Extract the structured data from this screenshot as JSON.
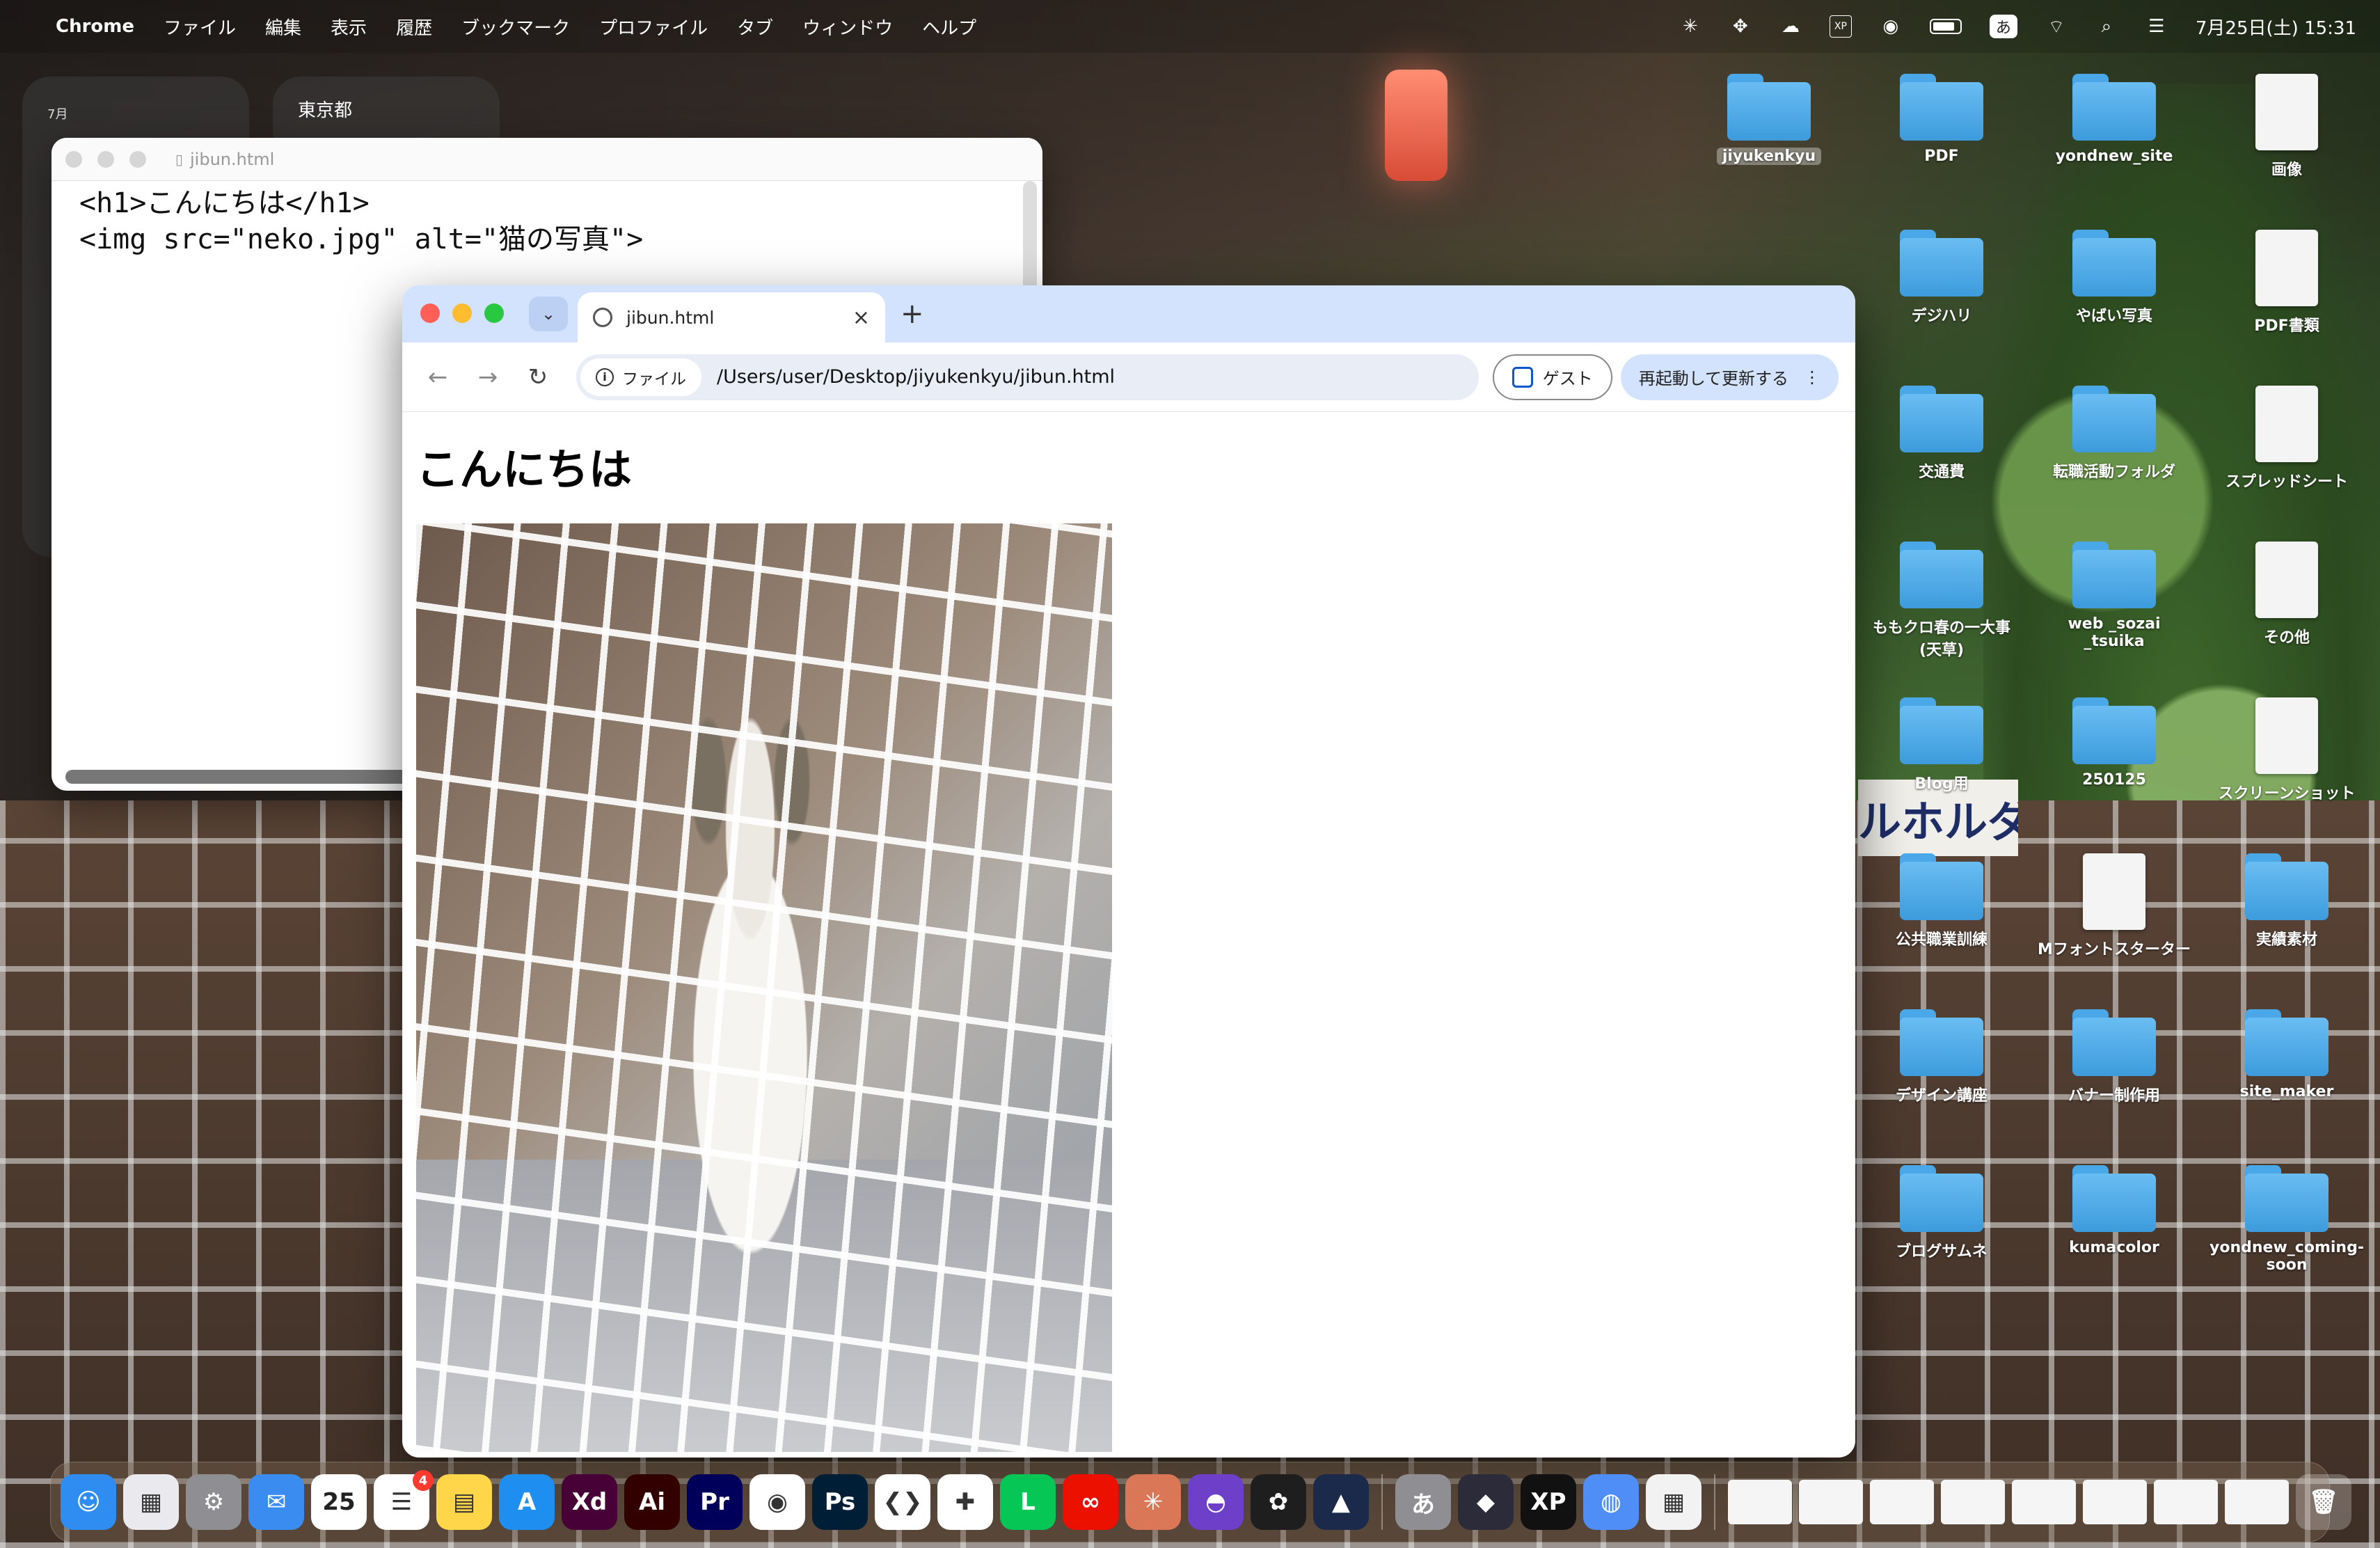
{
  "menubar": {
    "app_name": "Chrome",
    "menus": [
      "ファイル",
      "編集",
      "表示",
      "履歴",
      "ブックマーク",
      "プロファイル",
      "タブ",
      "ウィンドウ",
      "ヘルプ"
    ],
    "ime_label": "あ",
    "clock": "7月25日(土) 15:31"
  },
  "widgets": {
    "calendar_month": "7月",
    "weather_location": "東京都"
  },
  "editor": {
    "title": "jibun.html",
    "line1": "<h1>こんにちは</h1>",
    "line2": "<img src=\"neko.jpg\" alt=\"猫の写真\">"
  },
  "browser": {
    "tab_title": "jibun.html",
    "file_chip": "ファイル",
    "url": "/Users/user/Desktop/jiyukenkyu/jibun.html",
    "guest_label": "ゲスト",
    "relaunch_label": "再起動して更新する",
    "page_heading": "こんにちは",
    "image_alt": "猫の写真"
  },
  "wallpaper": {
    "sign_text": "ルホルダー"
  },
  "desktop": {
    "items": [
      {
        "label": "jiyukenkyu",
        "kind": "folder",
        "selected": true
      },
      {
        "label": "PDF",
        "kind": "folder"
      },
      {
        "label": "yondnew_site",
        "kind": "folder"
      },
      {
        "label": "画像",
        "kind": "doc"
      },
      {
        "label": "デジハリ",
        "kind": "folder"
      },
      {
        "label": "やばい写真",
        "kind": "folder"
      },
      {
        "label": "PDF書類",
        "kind": "doc"
      },
      {
        "label": "交通費",
        "kind": "folder"
      },
      {
        "label": "転職活動フォルダ",
        "kind": "folder"
      },
      {
        "label": "スプレッドシート",
        "kind": "doc"
      },
      {
        "label": "ももクロ春の一大事(天草)",
        "kind": "folder"
      },
      {
        "label": "web _sozai _tsuika",
        "kind": "folder"
      },
      {
        "label": "その他",
        "kind": "doc"
      },
      {
        "label": "Blog用",
        "kind": "folder"
      },
      {
        "label": "250125",
        "kind": "folder"
      },
      {
        "label": "スクリーンショット",
        "kind": "doc"
      },
      {
        "label": "公共職業訓練",
        "kind": "folder"
      },
      {
        "label": "Mフォントスターター",
        "kind": "doc"
      },
      {
        "label": "実績素材",
        "kind": "folder"
      },
      {
        "label": "デザイン講座",
        "kind": "folder"
      },
      {
        "label": "バナー制作用",
        "kind": "folder"
      },
      {
        "label": "site_maker",
        "kind": "folder"
      },
      {
        "label": "ブログサムネ",
        "kind": "folder"
      },
      {
        "label": "kumacolor",
        "kind": "folder"
      },
      {
        "label": "yondnew_coming-soon",
        "kind": "folder"
      }
    ]
  },
  "dock": {
    "calendar_day": "25",
    "reminders_badge": "4",
    "apps": [
      {
        "name": "finder-icon",
        "glyph": "☺",
        "color": "#2f8df2"
      },
      {
        "name": "launchpad-icon",
        "glyph": "▦",
        "color": "#e9e9ee"
      },
      {
        "name": "system-settings-icon",
        "glyph": "⚙",
        "color": "#8e8e93"
      },
      {
        "name": "mail-icon",
        "glyph": "✉",
        "color": "#3a8cf0"
      },
      {
        "name": "calendar-icon",
        "glyph": "",
        "color": "#ffffff"
      },
      {
        "name": "reminders-icon",
        "glyph": "☰",
        "color": "#ffffff"
      },
      {
        "name": "notes-icon",
        "glyph": "▤",
        "color": "#ffd54a"
      },
      {
        "name": "app-store-icon",
        "glyph": "A",
        "color": "#1f8ef1"
      },
      {
        "name": "adobe-xd-icon",
        "glyph": "Xd",
        "color": "#470137"
      },
      {
        "name": "illustrator-icon",
        "glyph": "Ai",
        "color": "#330000"
      },
      {
        "name": "premiere-icon",
        "glyph": "Pr",
        "color": "#00005b"
      },
      {
        "name": "chrome-icon",
        "glyph": "◉",
        "color": "#ffffff"
      },
      {
        "name": "photoshop-icon",
        "glyph": "Ps",
        "color": "#001e36"
      },
      {
        "name": "vscode-icon",
        "glyph": "❮❯",
        "color": "#ffffff"
      },
      {
        "name": "slack-icon",
        "glyph": "✚",
        "color": "#ffffff"
      },
      {
        "name": "line-icon",
        "glyph": "L",
        "color": "#06c755"
      },
      {
        "name": "creative-cloud-icon",
        "glyph": "∞",
        "color": "#eb1000"
      },
      {
        "name": "claude-icon",
        "glyph": "✳",
        "color": "#d97757"
      },
      {
        "name": "github-icon",
        "glyph": "◓",
        "color": "#6e40c9"
      },
      {
        "name": "figma-icon",
        "glyph": "✿",
        "color": "#1e1e1e"
      },
      {
        "name": "affinity-icon",
        "glyph": "▲",
        "color": "#1b2a4a"
      },
      {
        "name": "ime-icon",
        "glyph": "あ",
        "color": "#8e8e93"
      },
      {
        "name": "obsidian-icon",
        "glyph": "◆",
        "color": "#2b2b3a"
      },
      {
        "name": "xppen-icon",
        "glyph": "XP",
        "color": "#111111"
      },
      {
        "name": "cleanup-icon",
        "glyph": "◍",
        "color": "#4f8ef7"
      },
      {
        "name": "spreadsheet-app-icon",
        "glyph": "▦",
        "color": "#f2f2f2"
      }
    ]
  }
}
